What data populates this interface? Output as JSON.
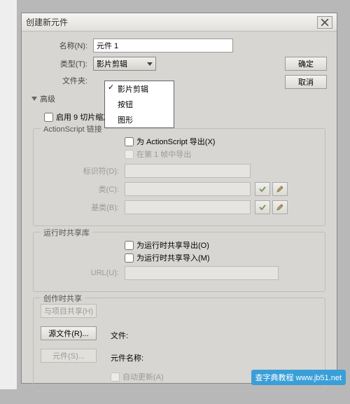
{
  "dialog": {
    "title": "创建新元件",
    "ok": "确定",
    "cancel": "取消"
  },
  "fields": {
    "name_label": "名称(N):",
    "name_value": "元件 1",
    "type_label": "类型(T):",
    "type_value": "影片剪辑",
    "folder_label": "文件夹:",
    "dropdown": {
      "opt1": "影片剪辑",
      "opt2": "按钮",
      "opt3": "图形"
    }
  },
  "advanced": {
    "title": "高级",
    "slice9": "启用 9 切片缩放比例辅助线(G)"
  },
  "as": {
    "title": "ActionScript 链接",
    "export": "为 ActionScript 导出(X)",
    "frame1": "在第 1 帧中导出",
    "id_label": "标识符(D):",
    "class_label": "类(C):",
    "base_label": "基类(B):"
  },
  "runtime": {
    "title": "运行时共享库",
    "export": "为运行时共享导出(O)",
    "import": "为运行时共享导入(M)",
    "url_label": "URL(U):"
  },
  "author": {
    "title": "创作时共享",
    "share_proj": "与项目共享(H)",
    "source": "源文件(R)...",
    "symbol": "元件(S)...",
    "file_label": "文件:",
    "symbol_label": "元件名称:",
    "autoupdate": "自动更新(A)"
  },
  "watermark": "查字典教程 www.jb51.net"
}
